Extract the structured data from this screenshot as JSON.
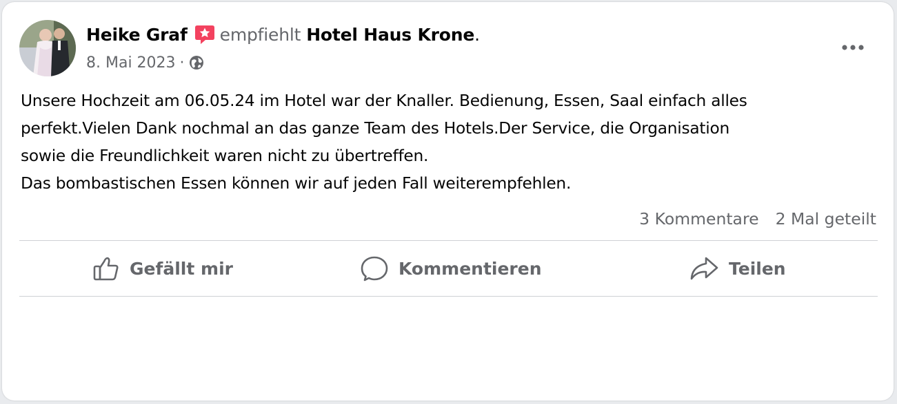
{
  "post": {
    "author": "Heike Graf",
    "verb": "empfiehlt",
    "page": "Hotel Haus Krone",
    "period": ".",
    "date": "8. Mai 2023",
    "separator": "·",
    "icons": {
      "recommend": "recommend-star-icon",
      "audience": "globe-icon",
      "more": "more-options-icon"
    },
    "body_lines": [
      "Unsere Hochzeit am 06.05.24 im Hotel war der Knaller. Bedienung, Essen, Saal einfach alles",
      "perfekt.Vielen Dank nochmal an das ganze Team des Hotels.Der Service, die Organisation",
      "sowie die Freundlichkeit waren nicht zu übertreffen.",
      "Das bombastischen Essen können wir auf jeden Fall weiterempfehlen."
    ],
    "stats": {
      "comments": "3 Kommentare",
      "shares": "2 Mal geteilt"
    }
  },
  "actions": {
    "like": "Gefällt mir",
    "comment": "Kommentieren",
    "share": "Teilen"
  },
  "colors": {
    "recommend_badge": "#f3425f",
    "secondary_text": "#65676b",
    "primary_text": "#050505",
    "divider": "#ced0d4"
  }
}
